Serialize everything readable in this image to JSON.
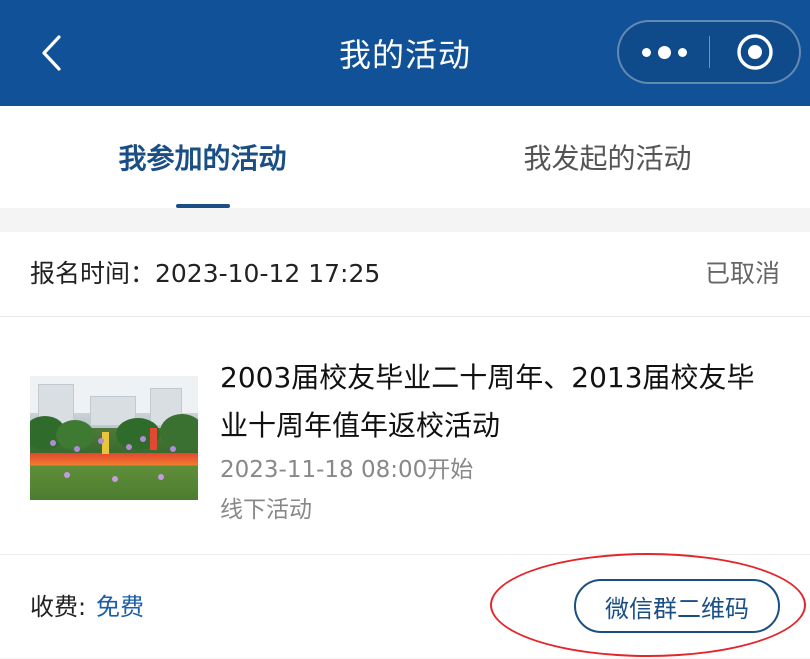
{
  "nav": {
    "title": "我的活动"
  },
  "tabs": [
    {
      "label": "我参加的活动",
      "active": true
    },
    {
      "label": "我发起的活动",
      "active": false
    }
  ],
  "record": {
    "registration_time": "报名时间：2023-10-12 17:25",
    "status": "已取消",
    "activity": {
      "title": "2003届校友毕业二十周年、2013届校友毕业十周年值年返校活动",
      "start_time": "2023-11-18 08:00开始",
      "type": "线下活动"
    },
    "fee_label": "收费:",
    "fee_value": "免费",
    "qr_button": "微信群二维码"
  },
  "colors": {
    "nav_bg": "#115197",
    "accent": "#1a4f86",
    "annotation": "#e3262b"
  }
}
